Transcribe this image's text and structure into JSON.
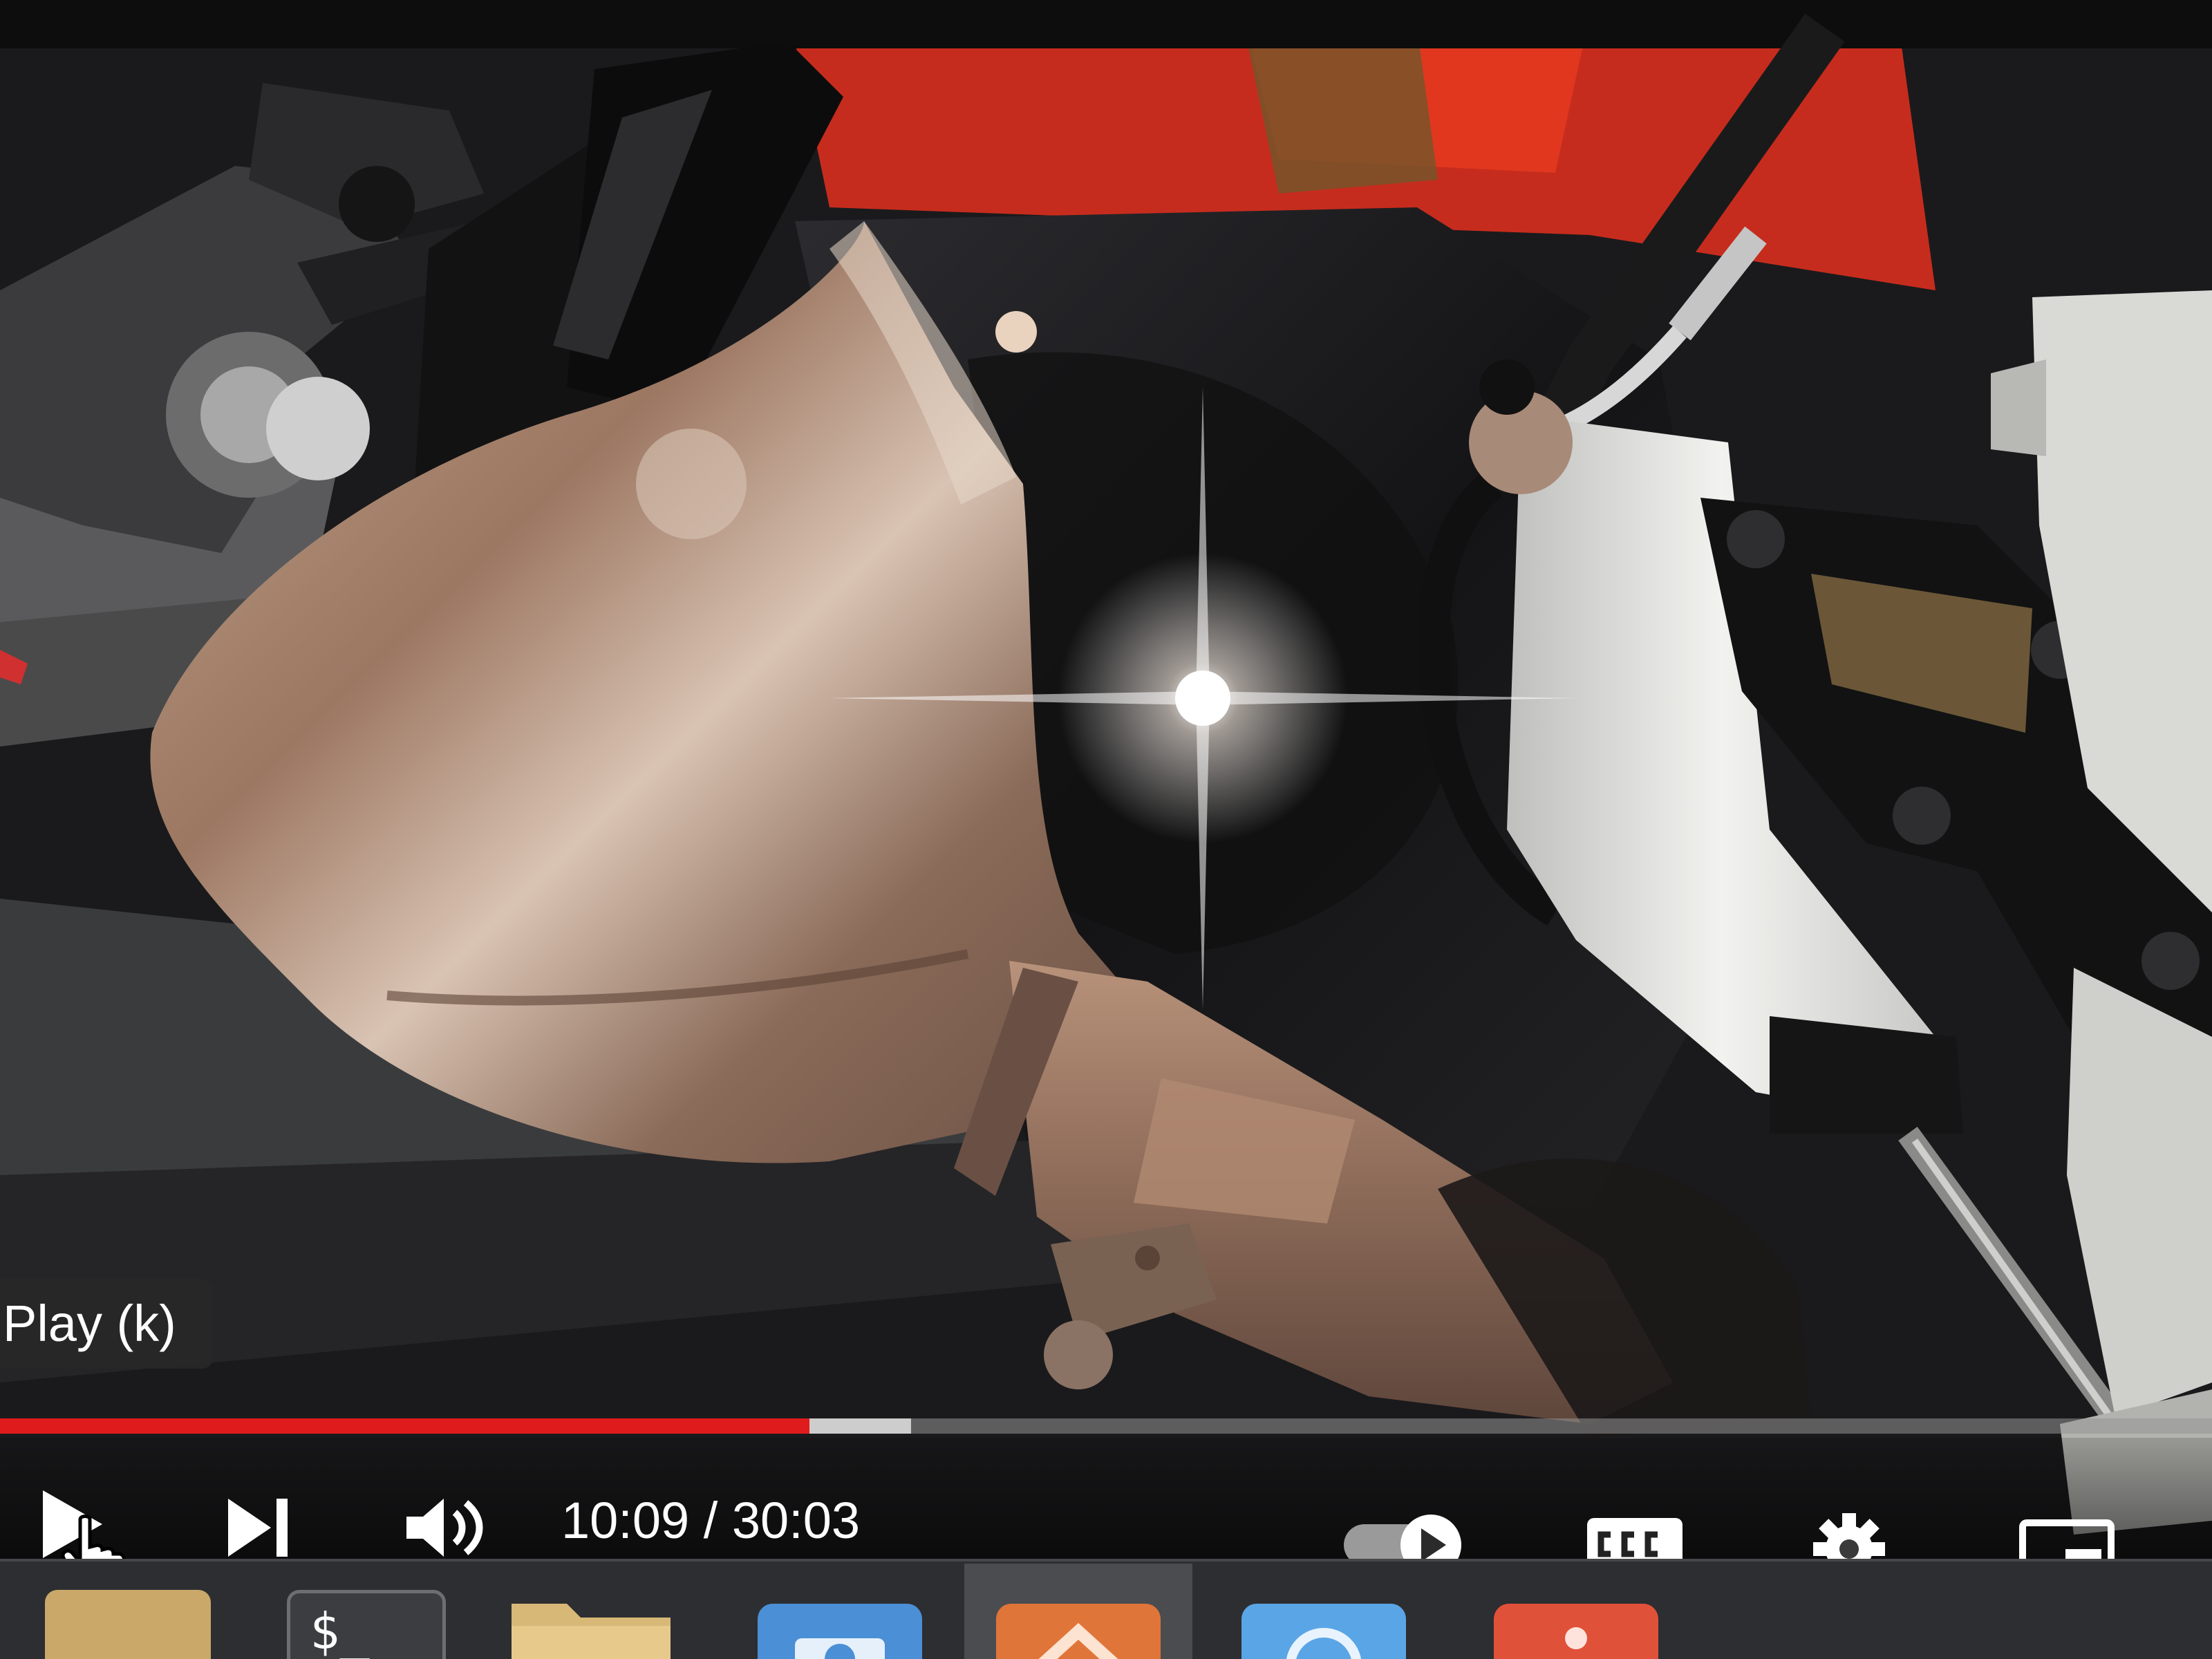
{
  "player": {
    "tooltip": "Play (k)",
    "progress_played_fraction": 0.366,
    "progress_buffered_fraction": 0.412,
    "progress_color": "#e01b1b",
    "time_current": "10:09",
    "time_separator": " / ",
    "time_total": "30:03",
    "controls": {
      "play": "play-icon",
      "next": "next-icon",
      "volume": "volume-icon",
      "autoplay": "autoplay-toggle-icon",
      "captions": "captions-icon",
      "settings": "gear-icon",
      "miniplayer": "miniplayer-icon"
    }
  },
  "taskbar": {
    "items": [
      {
        "name": "files-icon",
        "color": "#c9a86a"
      },
      {
        "name": "terminal-icon",
        "label": "$_",
        "color": "#3b3d41"
      },
      {
        "name": "folder-icon",
        "color": "#d8b877"
      },
      {
        "name": "screenshot-icon",
        "color": "#4b8fd6"
      },
      {
        "name": "app-orange-icon",
        "color": "#e0753a"
      },
      {
        "name": "browser-icon",
        "color": "#5aa5e6"
      },
      {
        "name": "app-red-icon",
        "color": "#e0513a"
      }
    ]
  },
  "colors": {
    "exhaust": "#a8866f",
    "swingarm": "#1b1b1e",
    "red_accent": "#d2301f",
    "master_cylinder": "#e6e6e4"
  }
}
